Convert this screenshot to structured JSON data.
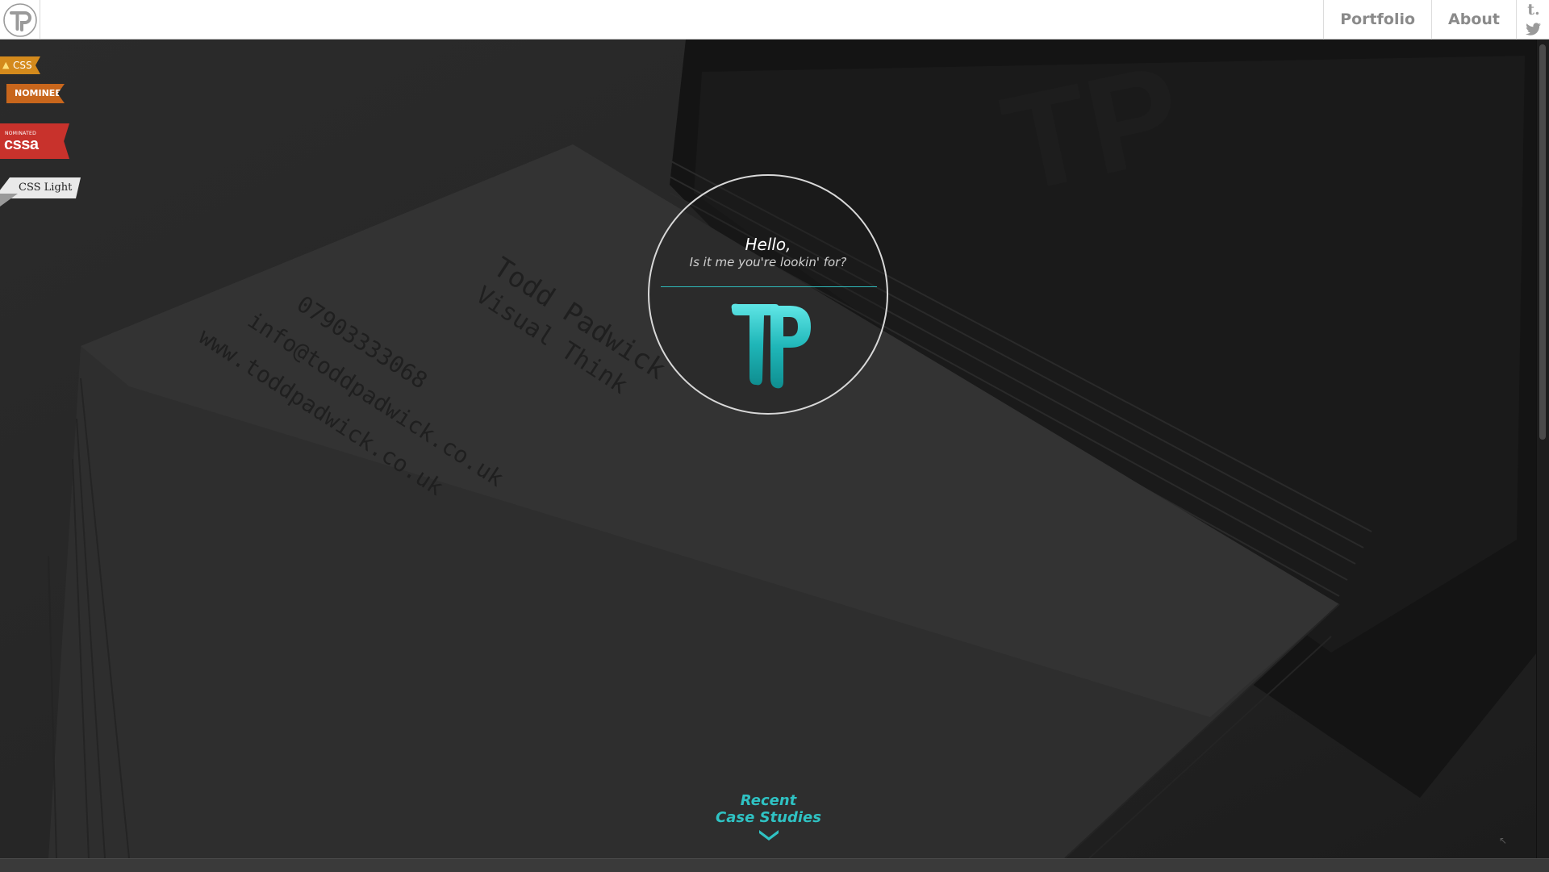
{
  "header": {
    "logo_alt": "TP",
    "nav": [
      {
        "label": "Portfolio"
      },
      {
        "label": "About"
      }
    ],
    "social": [
      {
        "name": "tumblr",
        "glyph": "t.",
        "icon": "tumblr-icon"
      },
      {
        "name": "twitter",
        "icon": "twitter-icon"
      }
    ]
  },
  "badges": {
    "css_label": "CSS",
    "nominee_label": "NOMINEE",
    "cssa_small": "NOMINATED",
    "cssa_big": "cssa",
    "css_light_label": "CSS Light"
  },
  "hero": {
    "greeting": "Hello,",
    "subtitle": "Is it me you're lookin' for?",
    "logo": "TP"
  },
  "footer_cta": {
    "line1": "Recent",
    "line2": "Case Studies",
    "icon": "chevron-down-icon"
  },
  "colors": {
    "accent": "#2fc2c3",
    "topbar": "#ffffff",
    "nav_text": "#8a8a8a",
    "background": "#242424"
  }
}
